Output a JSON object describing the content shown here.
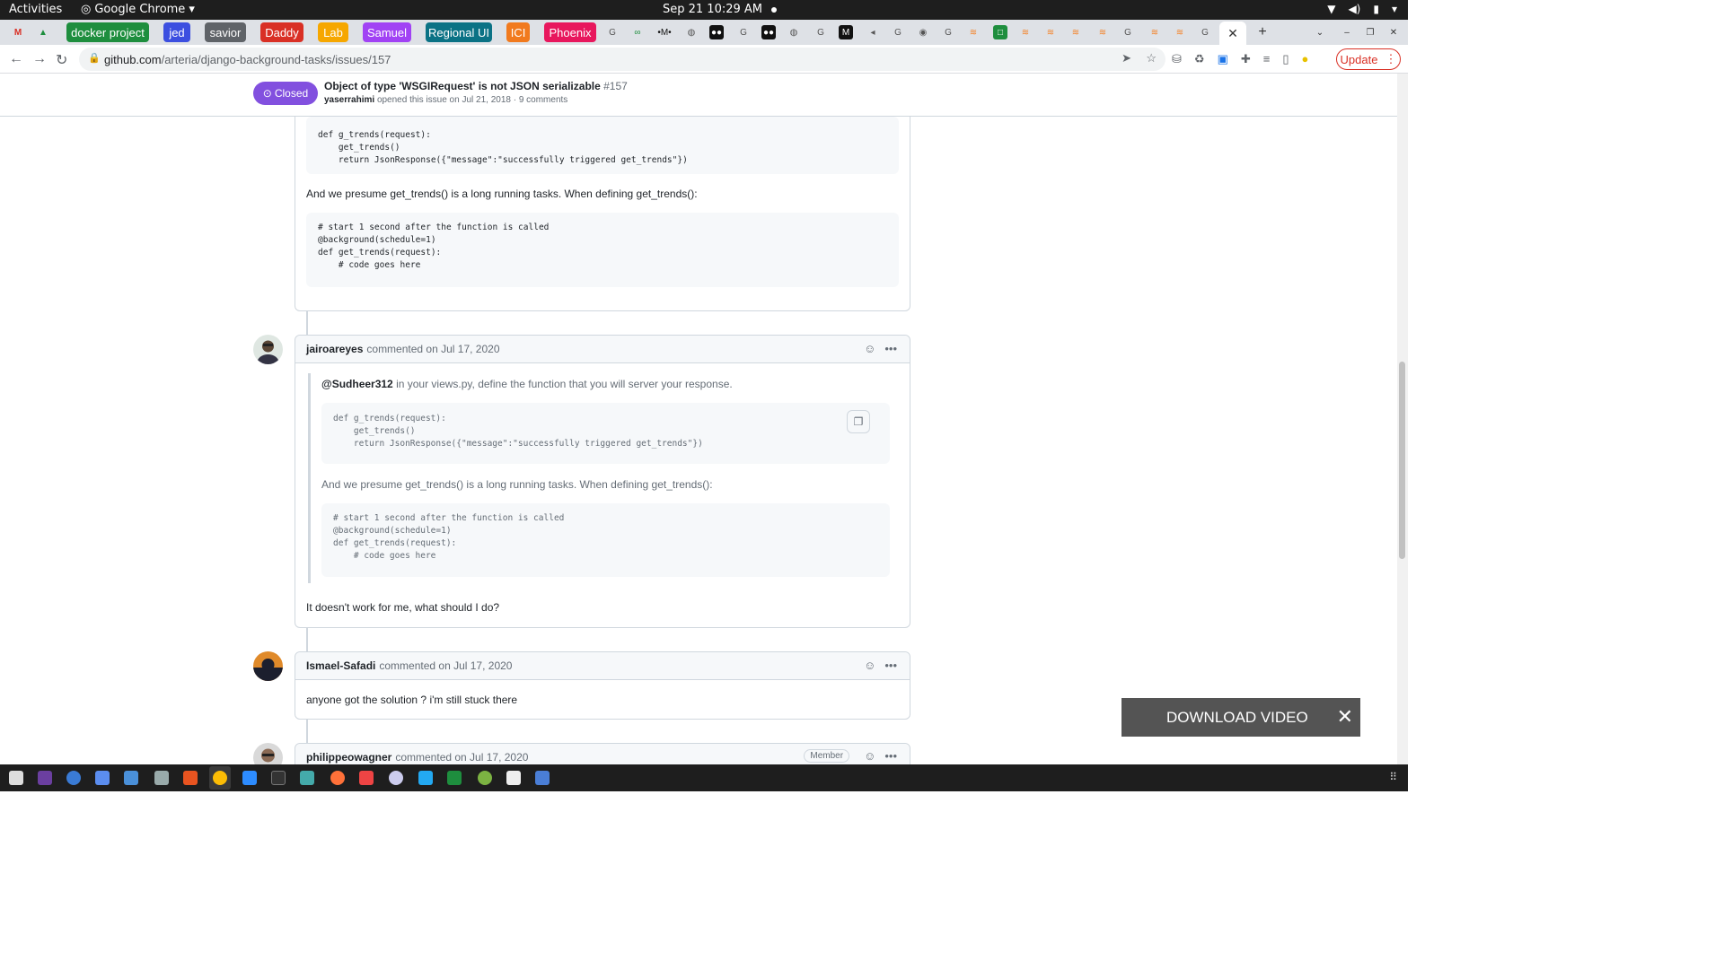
{
  "system_bar": {
    "activities": "Activities",
    "app_name": "Google Chrome",
    "clock": "Sep 21  10:29 AM"
  },
  "bookmarks": [
    {
      "label": "docker project",
      "color": "#1e8e3e"
    },
    {
      "label": "jed",
      "color": "#3c4fe0"
    },
    {
      "label": "savior",
      "color": "#5f6368"
    },
    {
      "label": "Daddy",
      "color": "#d93025"
    },
    {
      "label": "Lab",
      "color": "#f6a700"
    },
    {
      "label": "Samuel",
      "color": "#a142f4"
    },
    {
      "label": "Regional UI",
      "color": "#0b7285"
    },
    {
      "label": "ICI",
      "color": "#f17a1e"
    },
    {
      "label": "Phoenix",
      "color": "#e8175d"
    }
  ],
  "address_bar": {
    "url_host": "github.com",
    "url_path": "/arteria/django-background-tasks/issues/157",
    "update_label": "Update"
  },
  "issue": {
    "state": "Closed",
    "title": "Object of type 'WSGIRequest' is not JSON serializable",
    "number": "#157",
    "author": "yaserrahimi",
    "meta": "opened this issue on Jul 21, 2018 · 9 comments"
  },
  "first_card": {
    "code1": "def g_trends(request):\n    get_trends()\n    return JsonResponse({\"message\":\"successfully triggered get_trends\"})",
    "text": "And we presume get_trends() is a long running tasks. When defining get_trends():",
    "code2": "# start 1 second after the function is called\n@background(schedule=1)\ndef get_trends(request):\n    # code goes here"
  },
  "comments": [
    {
      "user": "jairoareyes",
      "when": "commented on Jul 17, 2020",
      "quote_mention": "@Sudheer312",
      "quote_text": " in your views.py, define the function that you will server your response.",
      "quote_code1": "def g_trends(request):\n    get_trends()\n    return JsonResponse({\"message\":\"successfully triggered get_trends\"})",
      "quote_text2": "And we presume get_trends() is a long running tasks. When defining get_trends():",
      "quote_code2": "# start 1 second after the function is called\n@background(schedule=1)\ndef get_trends(request):\n    # code goes here",
      "body": "It doesn't work for me, what should I do?"
    },
    {
      "user": "Ismael-Safadi",
      "when": "commented on Jul 17, 2020",
      "body": "anyone got the solution ? i'm still stuck there"
    },
    {
      "user": "philippeowagner",
      "when": "commented on Jul 17, 2020",
      "badge": "Member"
    }
  ],
  "overlay": {
    "download_label": "DOWNLOAD VIDEO"
  }
}
